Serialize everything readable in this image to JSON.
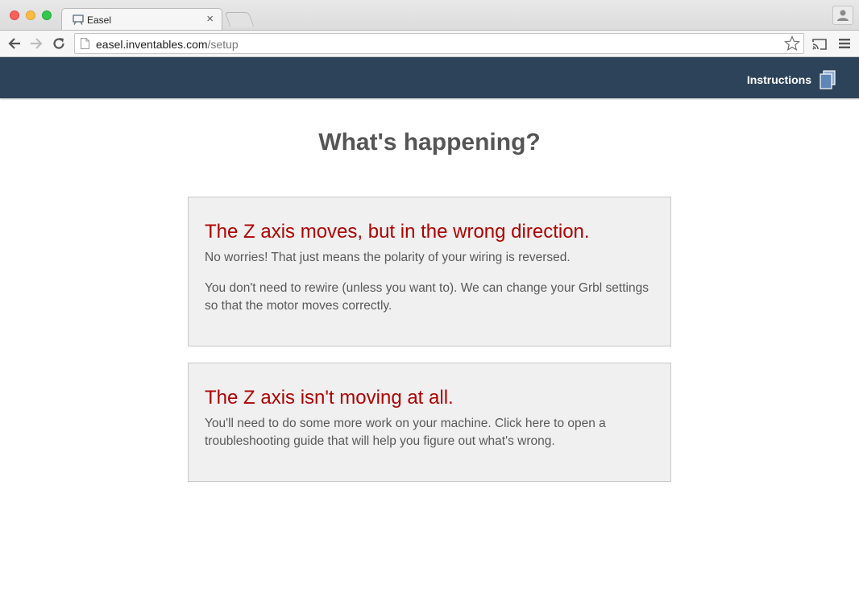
{
  "browser": {
    "tab_title": "Easel",
    "tab_close": "×",
    "url_host": "easel.inventables.com",
    "url_path": "/setup"
  },
  "header": {
    "instructions_label": "Instructions",
    "background_color": "#2d4359"
  },
  "main": {
    "title": "What's happening?",
    "accent_color": "#b00000",
    "options": [
      {
        "title": "The Z axis moves, but in the wrong direction.",
        "paragraphs": [
          "No worries! That just means the polarity of your wiring is reversed.",
          "You don't need to rewire (unless you want to). We can change your Grbl settings so that the motor moves correctly."
        ]
      },
      {
        "title": "The Z axis isn't moving at all.",
        "paragraphs": [
          "You'll need to do some more work on your machine. Click here to open a troubleshooting guide that will help you figure out what's wrong."
        ]
      }
    ]
  },
  "icons": {
    "tab_favicon": "easel-favicon-icon",
    "instructions": "copy-pages-icon"
  }
}
